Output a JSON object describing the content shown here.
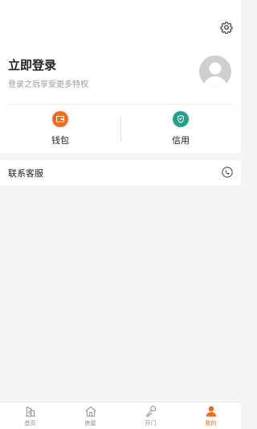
{
  "header": {
    "login_title": "立即登录",
    "login_subtitle": "登录之后享受更多特权"
  },
  "quick_actions": [
    {
      "label": "钱包",
      "icon": "wallet-icon",
      "color": "#f26a1b"
    },
    {
      "label": "信用",
      "icon": "credit-shield-icon",
      "color": "#22a08c"
    }
  ],
  "contact": {
    "label": "联系客服",
    "icon": "phone-icon"
  },
  "tabbar": {
    "items": [
      {
        "label": "首页",
        "icon": "home-icon",
        "active": false
      },
      {
        "label": "房屋",
        "icon": "house-icon",
        "active": false
      },
      {
        "label": "开门",
        "icon": "key-icon",
        "active": false
      },
      {
        "label": "我的",
        "icon": "profile-icon",
        "active": true
      }
    ]
  },
  "colors": {
    "accent": "#f26a1b",
    "credit": "#22a08c",
    "background": "#f5f5f5"
  }
}
